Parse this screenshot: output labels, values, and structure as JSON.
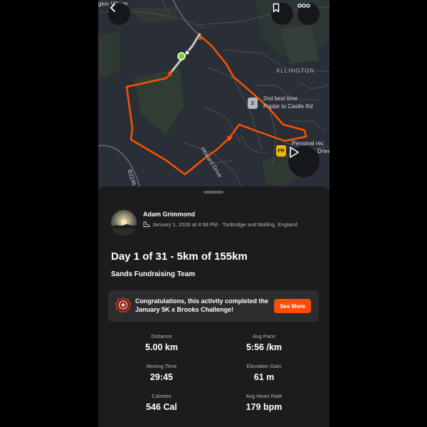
{
  "map": {
    "place_top_left": "gion Village",
    "area_label": "ALLINGTON",
    "road_label_1": "Howard Drive",
    "road_label_2": "B2246",
    "segment_badge": "2",
    "segment_text_line1": "2nd best time",
    "segment_text_line2": "Poplar to Castle Rd",
    "pr_badge": "PR",
    "pr_text_line1": "Personal rec",
    "pr_text_line2": "Drive",
    "route_color": "#fc5200",
    "start_color": "#7ed321"
  },
  "icons": {
    "back": "chevron-left-icon",
    "bookmark": "bookmark-icon",
    "more": "more-horizontal-icon",
    "play": "play-icon",
    "shoe": "shoe-icon",
    "challenge": "challenge-badge-icon"
  },
  "activity": {
    "athlete_name": "Adam Grimmond",
    "meta": "January 1, 2026 at 4:58 PM · Tonbridge and Malling, England",
    "title": "Day 1 of 31 - 5km of 155km",
    "club": "Sands Fundraising Team"
  },
  "challenge": {
    "text": "Congratulations, this activity completed the January 5K x Brooks Challenge!",
    "button": "See More"
  },
  "stats": {
    "distance_label": "Distance",
    "distance_value": "5.00 km",
    "pace_label": "Avg Pace",
    "pace_value": "5:56 /km",
    "time_label": "Moving Time",
    "time_value": "29:45",
    "elev_label": "Elevation Gain",
    "elev_value": "61 m",
    "cal_label": "Calories",
    "cal_value": "546 Cal",
    "hr_label": "Avg Heart Rate",
    "hr_value": "179 bpm"
  },
  "accent_color": "#fc4c02"
}
